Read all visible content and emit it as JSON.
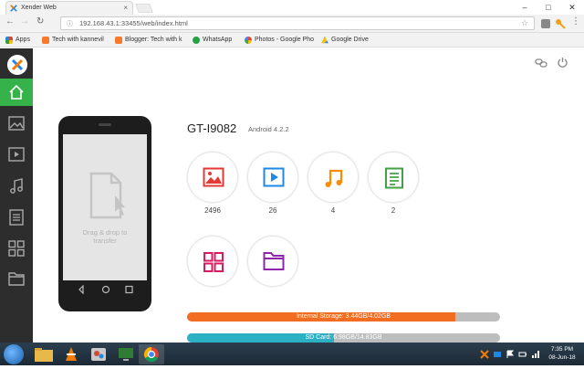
{
  "browser": {
    "tab_title": "Xender Web",
    "tab_close": "×",
    "url": "192.168.43.1:33455/web/index.html",
    "window_min": "–",
    "window_max": "□",
    "window_close": "✕"
  },
  "bookmarks": [
    {
      "label": "Apps",
      "color": "#d04a3a"
    },
    {
      "label": "Tech with kannevil",
      "color": "#f57b2b"
    },
    {
      "label": "Blogger: Tech with k",
      "color": "#f57b2b"
    },
    {
      "label": "WhatsApp",
      "color": "#25a244"
    },
    {
      "label": "Photos - Google Pho",
      "color": "#6c7fd8"
    },
    {
      "label": "Google Drive",
      "color": "#f4c20d"
    }
  ],
  "phone": {
    "drop_text_1": "Drag & drop to",
    "drop_text_2": "transfer"
  },
  "device": {
    "name": "GT-I9082",
    "os": "Android 4.2.2"
  },
  "categories": [
    {
      "name": "photos",
      "count": "2496",
      "color": "#e53935"
    },
    {
      "name": "videos",
      "count": "26",
      "color": "#1e88e5"
    },
    {
      "name": "music",
      "count": "4",
      "color": "#fb8c00"
    },
    {
      "name": "documents",
      "count": "2",
      "color": "#43a047"
    },
    {
      "name": "apps",
      "count": "",
      "color": "#d81b60"
    },
    {
      "name": "files",
      "count": "",
      "color": "#8e24aa"
    }
  ],
  "storage": {
    "internal": {
      "label": "Internal Storage: 3.44GB/4.02GB",
      "fraction": 0.856,
      "color": "#f26d21"
    },
    "sdcard": {
      "label": "SD Card: 6.98GB/14.83GB",
      "fraction": 0.47,
      "color": "#2bb0c4"
    }
  },
  "taskbar": {
    "time": "7:35 PM",
    "date": "08-Jun-18"
  }
}
